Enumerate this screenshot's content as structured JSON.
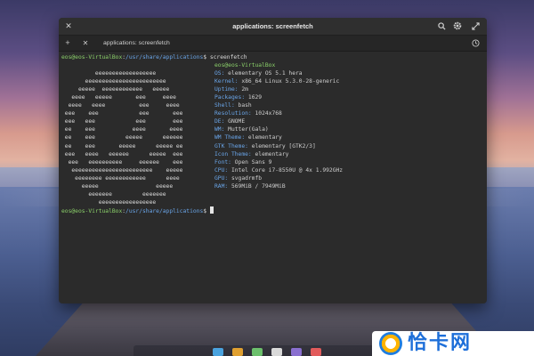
{
  "window": {
    "title": "applications: screenfetch",
    "close_icon": "close-icon",
    "search_icon": "search-icon",
    "settings_icon": "gear-icon",
    "maximize_icon": "maximize-icon"
  },
  "tabs": {
    "new_tab_icon": "plus-icon",
    "close_tab_icon": "close-icon",
    "active_tab_label": "applications: screenfetch",
    "history_icon": "clock-icon"
  },
  "terminal": {
    "prompt_user": "eos@eos-VirtualBox",
    "prompt_path": "/usr/share/applications",
    "command": "screenfetch",
    "logo_lines": [
      "",
      "          eeeeeeeeeeeeeeeeee",
      "       eeeeeeeeeeeeeeeeeeeeeeee",
      "     eeeee  eeeeeeeeeeee   eeeee",
      "   eeee   eeeee       eee     eeee",
      "  eeee   eeee          eee     eeee",
      " eee    eee            eee       eee",
      " eee   eee            eee        eee",
      " ee    eee           eeee       eeee",
      " ee    eee         eeeee      eeeeee",
      " ee    eee       eeeee      eeeee ee",
      " eee   eeee   eeeeee      eeeee  eee",
      "  eee   eeeeeeeeee     eeeeee    eee",
      "   eeeeeeeeeeeeeeeeeeeeeeee    eeeee",
      "    eeeeeeee eeeeeeeeeeee      eeee",
      "      eeeee                 eeeee",
      "        eeeeeee         eeeeeee",
      "           eeeeeeeeeeeeeeeee"
    ],
    "info": [
      {
        "key": "",
        "value": "eos@eos-VirtualBox"
      },
      {
        "key": "OS:",
        "value": "elementary OS 5.1 hera"
      },
      {
        "key": "Kernel:",
        "value": "x86_64 Linux 5.3.0-28-generic"
      },
      {
        "key": "Uptime:",
        "value": "2m"
      },
      {
        "key": "Packages:",
        "value": "1629"
      },
      {
        "key": "Shell:",
        "value": "bash"
      },
      {
        "key": "Resolution:",
        "value": "1024x768"
      },
      {
        "key": "DE:",
        "value": "GNOME"
      },
      {
        "key": "WM:",
        "value": "Mutter(Gala)"
      },
      {
        "key": "WM Theme:",
        "value": "elementary"
      },
      {
        "key": "GTK Theme:",
        "value": "elementary [GTK2/3]"
      },
      {
        "key": "Icon Theme:",
        "value": "elementary"
      },
      {
        "key": "Font:",
        "value": "Open Sans 9"
      },
      {
        "key": "CPU:",
        "value": "Intel Core i7-8550U @ 4x 1.992GHz"
      },
      {
        "key": "GPU:",
        "value": "svgadrmfb"
      },
      {
        "key": "RAM:",
        "value": "569MiB / 7949MiB"
      }
    ]
  },
  "watermark": {
    "text": "恰卡网"
  },
  "colors": {
    "prompt_user": "#8bd16a",
    "prompt_path": "#6aa5e8",
    "info_key": "#6aa5e8",
    "terminal_bg": "#2b2b2b"
  }
}
